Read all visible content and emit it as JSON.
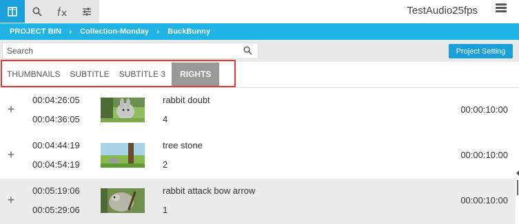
{
  "app": {
    "title": "TestAudio25fps"
  },
  "toolbar": {
    "tools": [
      {
        "icon": "panel-layout-icon",
        "active": true
      },
      {
        "icon": "search-icon",
        "active": false
      },
      {
        "icon": "effects-fx-icon",
        "active": false
      },
      {
        "icon": "sliders-icon",
        "active": false
      }
    ],
    "menu_icon": "hamburger-menu-icon"
  },
  "breadcrumb": [
    "PROJECT BIN",
    "Collection-Monday",
    "BuckBunny"
  ],
  "search": {
    "placeholder": "Search",
    "value": "",
    "icon": "search-icon"
  },
  "project_setting_label": "Project Setting",
  "tabs": [
    {
      "label": "THUMBNAILS",
      "selected": false
    },
    {
      "label": "SUBTITLE",
      "selected": false
    },
    {
      "label": "SUBTITLE 3",
      "selected": false
    },
    {
      "label": "RIGHTS",
      "selected": true
    }
  ],
  "clips": [
    {
      "tc_in": "00:04:26:05",
      "tc_out": "00:04:36:05",
      "name": "rabbit doubt",
      "number": "4",
      "duration": "00:00:10:00",
      "highlighted": false
    },
    {
      "tc_in": "00:04:44:19",
      "tc_out": "00:04:54:19",
      "name": "tree stone",
      "number": "2",
      "duration": "00:00:10:00",
      "highlighted": false
    },
    {
      "tc_in": "00:05:19:06",
      "tc_out": "00:05:29:06",
      "name": "rabbit attack bow arrow",
      "number": "1",
      "duration": "00:00:10:00",
      "highlighted": true
    }
  ],
  "colors": {
    "accent": "#1a9fd8",
    "breadcrumb_bg": "#1fb3e6",
    "selected_tab_bg": "#999999",
    "annotation_outline": "#e53935",
    "highlight_row": "#ececec"
  }
}
